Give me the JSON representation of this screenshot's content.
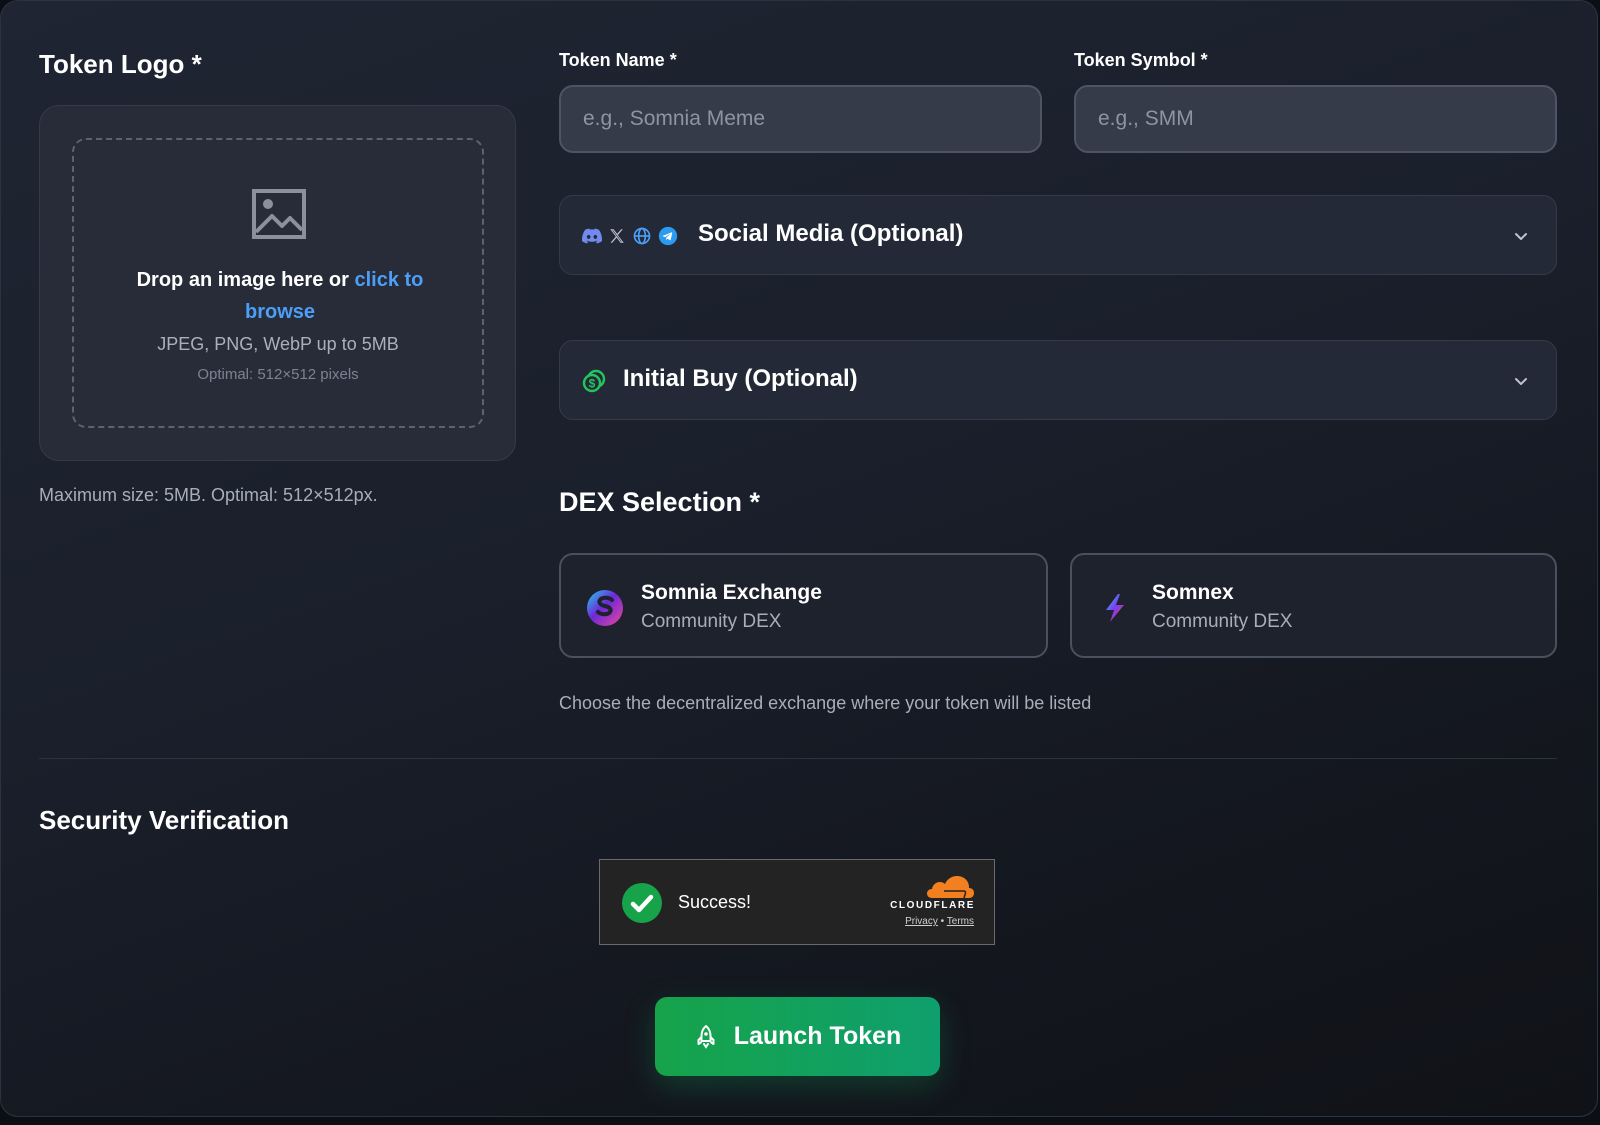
{
  "token_logo": {
    "title": "Token Logo *",
    "drop_text": "Drop an image here or ",
    "browse_link": "click to browse",
    "formats": "JPEG, PNG, WebP up to 5MB",
    "optimal": "Optimal: 512×512 pixels",
    "max_size_note": "Maximum size: 5MB. Optimal: 512×512px.",
    "icon": "image-icon"
  },
  "token_name": {
    "label": "Token Name *",
    "value": "",
    "placeholder": "e.g., Somnia Meme"
  },
  "token_symbol": {
    "label": "Token Symbol *",
    "value": "",
    "placeholder": "e.g., SMM"
  },
  "social_media": {
    "title": "Social Media (Optional)",
    "icons": [
      "discord-icon",
      "x-icon",
      "globe-icon",
      "telegram-icon"
    ]
  },
  "initial_buy": {
    "title": "Initial Buy (Optional)",
    "icon": "coins-icon"
  },
  "dex": {
    "title": "DEX Selection *",
    "options": [
      {
        "name": "Somnia Exchange",
        "subtitle": "Community DEX"
      },
      {
        "name": "Somnex",
        "subtitle": "Community DEX"
      }
    ],
    "hint": "Choose the decentralized exchange where your token will be listed"
  },
  "security": {
    "title": "Security Verification",
    "status": "Success!",
    "provider": "CLOUDFLARE",
    "privacy": "Privacy",
    "separator": "•",
    "terms": "Terms"
  },
  "launch": {
    "label": "Launch Token",
    "icon": "rocket-icon"
  },
  "colors": {
    "accent_link": "#4d9ef7",
    "launch_green": "#16a34a",
    "cloudflare_orange": "#f38020"
  }
}
